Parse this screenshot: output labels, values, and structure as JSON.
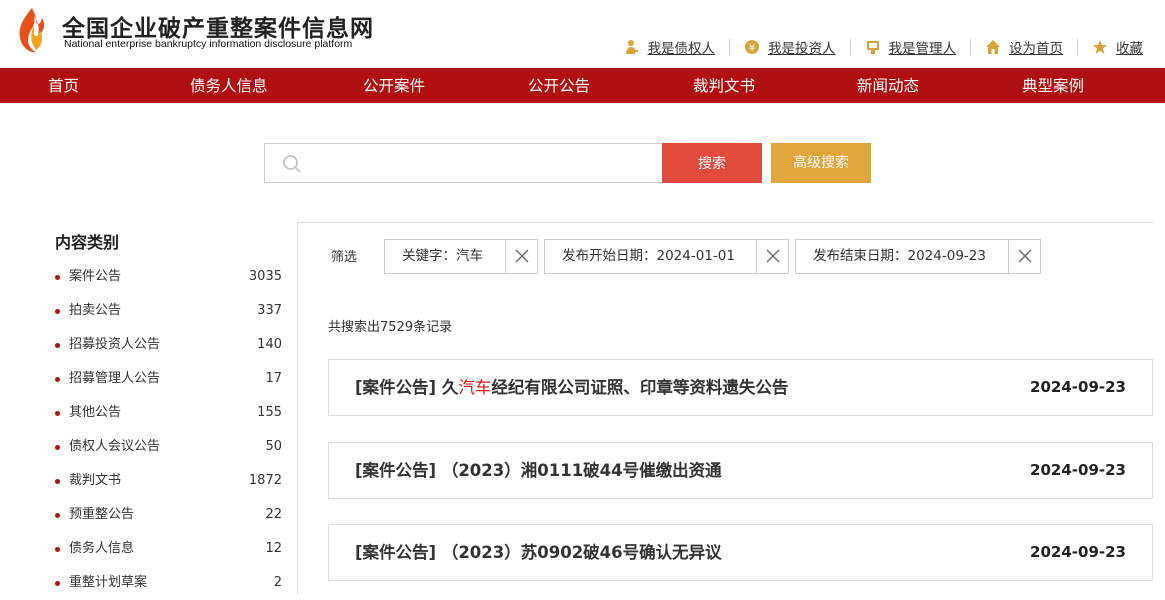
{
  "header": {
    "title": "全国企业破产重整案件信息网",
    "subtitle": "National enterprise bankruptcy  information disclosure platform",
    "links": [
      {
        "label": "我是债权人",
        "icon": "creditor-icon"
      },
      {
        "label": "我是投资人",
        "icon": "investor-icon"
      },
      {
        "label": "我是管理人",
        "icon": "manager-icon"
      },
      {
        "label": "设为首页",
        "icon": "home-icon"
      },
      {
        "label": "收藏",
        "icon": "star-icon"
      }
    ]
  },
  "nav": {
    "items": [
      "首页",
      "债务人信息",
      "公开案件",
      "公开公告",
      "裁判文书",
      "新闻动态",
      "典型案例"
    ]
  },
  "search": {
    "value": "",
    "placeholder": "",
    "search_label": "搜索",
    "advanced_label": "高级搜索"
  },
  "sidebar": {
    "title": "内容类别",
    "items": [
      {
        "name": "案件公告",
        "count": "3035"
      },
      {
        "name": "拍卖公告",
        "count": "337"
      },
      {
        "name": "招募投资人公告",
        "count": "140"
      },
      {
        "name": "招募管理人公告",
        "count": "17"
      },
      {
        "name": "其他公告",
        "count": "155"
      },
      {
        "name": "债权人会议公告",
        "count": "50"
      },
      {
        "name": "裁判文书",
        "count": "1872"
      },
      {
        "name": "预重整公告",
        "count": "22"
      },
      {
        "name": "债务人信息",
        "count": "12"
      },
      {
        "name": "重整计划草案",
        "count": "2"
      }
    ]
  },
  "filters": {
    "label": "筛选",
    "chips": [
      {
        "label": "关键字：汽车"
      },
      {
        "label": "发布开始日期：2024-01-01"
      },
      {
        "label": "发布结束日期：2024-09-23"
      }
    ]
  },
  "results": {
    "summary": "共搜索出7529条记录",
    "items": [
      {
        "prefix": "[案件公告] 久",
        "highlight": "汽车",
        "suffix": "经纪有限公司证照、印章等资料遗失公告",
        "date": "2024-09-23"
      },
      {
        "prefix": "[案件公告] （2023）湘0111破44号催缴出资通",
        "highlight": "",
        "suffix": "",
        "date": "2024-09-23"
      },
      {
        "prefix": "[案件公告] （2023）苏0902破46号确认无异议",
        "highlight": "",
        "suffix": "",
        "date": "2024-09-23"
      }
    ]
  },
  "colors": {
    "nav_bg": "#b01012",
    "search_button": "#e24a3b",
    "advanced_button": "#e2a53c",
    "highlight": "#d4161a"
  }
}
